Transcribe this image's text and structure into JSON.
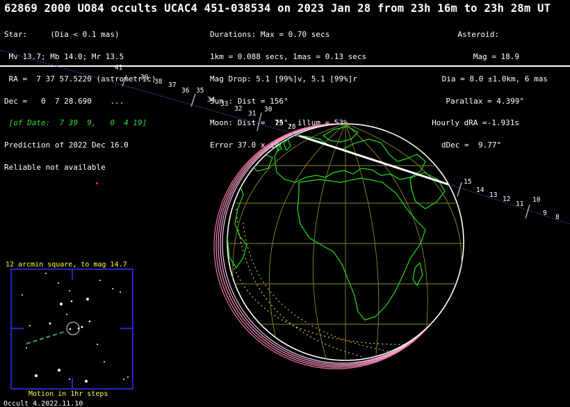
{
  "header": {
    "title": "62869 2000 UO84 occults UCAC4 451-038534 on 2023 Jan 28 from 23h 16m to 23h 28m UT",
    "star_lines": [
      "Star:     (Dia < 0.1 mas)",
      " Mv 13.7; Mb 14.0; Mr 13.5",
      " RA =  7 37 57.5220 (astrometric)",
      "Dec =   0  7 28.690    ...",
      " [of Date:  7 39  9,   0  4 19]",
      "Prediction of 2022 Dec 16.0",
      "Reliable not available"
    ],
    "event_lines": [
      "Durations: Max = 0.70 secs",
      "1km = 0.088 secs, 1mas = 0.13 secs",
      "Mag Drop: 5.1 [99%]v, 5.1 [99%]r",
      "Sun : Dist = 156°",
      "Moon: Dist =  75°, illum = 53%",
      "Error 37.0 x 19.0 mas in PA 102°"
    ],
    "asteroid_lines": [
      "Asteroid:",
      "Mag = 18.9",
      "Dia = 8.0 ±1.0km, 6 mas",
      "Parallax = 4.399\"",
      "Hourly dRA =-1.931s",
      "dDec =  9.77\""
    ]
  },
  "path_labels": {
    "upper": [
      "41",
      "39",
      "38",
      "37",
      "36",
      "35",
      "34",
      "33",
      "32",
      "31",
      "30",
      "29",
      "28"
    ],
    "lower": [
      "15",
      "14",
      "13",
      "12",
      "11",
      "10",
      "9",
      "8"
    ]
  },
  "starchart": {
    "title": "12 arcmin square, to mag 14.7",
    "caption": "Motion in 1hr steps"
  },
  "footer": "Occult 4.2022.11.10",
  "colors": {
    "background": "#000000",
    "text": "#ffffff",
    "coastline": "#22dd22",
    "graticule": "#8a8a2a",
    "shadow_path": "#ffffff",
    "path_line": "#7744cc",
    "starchart_frame": "#3333ff",
    "starchart_text": "#ffff33",
    "target_star": "#ff2222"
  }
}
